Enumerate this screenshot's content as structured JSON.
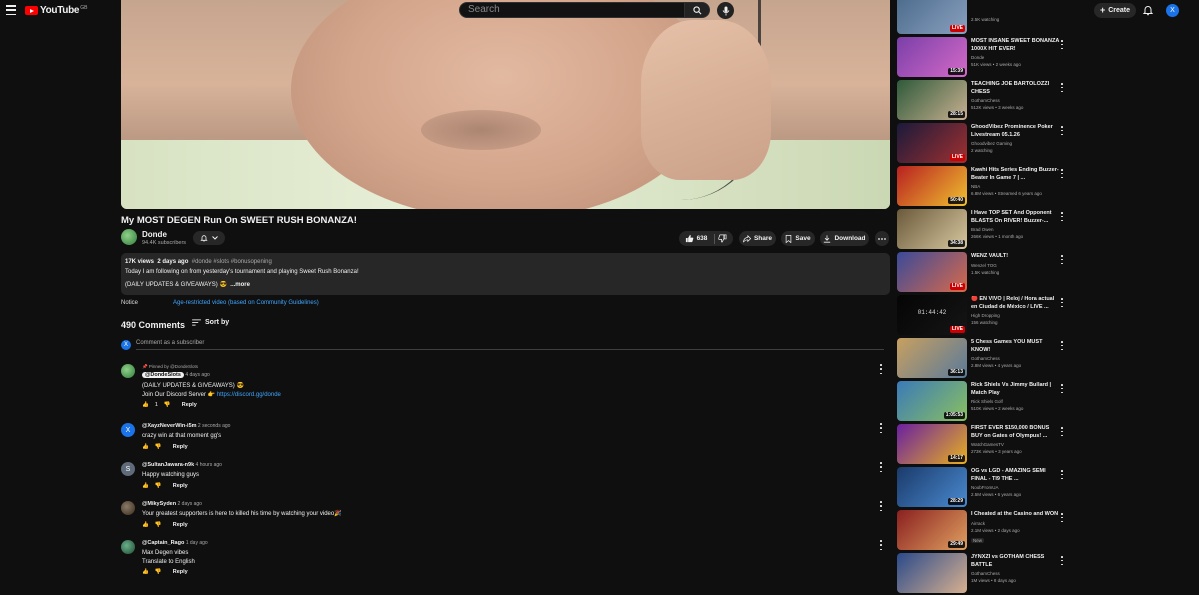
{
  "header": {
    "logo_text": "YouTube",
    "logo_country": "GB",
    "search_placeholder": "Search",
    "create_label": "Create",
    "user_initial": "X"
  },
  "video": {
    "title": "My MOST DEGEN Run On SWEET RUSH BONANZA!",
    "channel_name": "Donde",
    "subscribers": "94.4K subscribers",
    "likes": "638",
    "share_label": "Share",
    "save_label": "Save",
    "download_label": "Download"
  },
  "description": {
    "views": "17K views",
    "age": "2 days ago",
    "hashtags": "#donde #slots #bonusopening",
    "line1": "Today I am following on from yesterday's tournament and playing Sweet Rush Bonanza!",
    "line2": "(DAILY UPDATES & GIVEAWAYS) 😎",
    "more": "...more"
  },
  "notice": {
    "label": "Notice",
    "text": "Age-restricted video (based on Community Guidelines)"
  },
  "comments": {
    "count": "490 Comments",
    "sort_label": "Sort by",
    "add_placeholder": "Comment as a subscriber",
    "add_avatar_initial": "X",
    "reply_label": "Reply",
    "items": [
      {
        "pinned_text": "Pinned by @DondeSlots",
        "author": "@DondeSlots",
        "age": "4 days ago",
        "line1": "(DAILY UPDATES & GIVEAWAYS) 😎",
        "line2_prefix": "Join Our Discord Server 👉",
        "link": "https://discord.gg/donde",
        "likes": "1",
        "avatar_color": "#3b8a3e",
        "avatar_initial": ""
      },
      {
        "author": "@XayzNeverWin-i5m",
        "age": "2 seconds ago",
        "line1": "crazy win at that moment gg's",
        "avatar_color": "#1a73e8",
        "avatar_initial": "X"
      },
      {
        "author": "@SultanJawara-n9k",
        "age": "4 hours ago",
        "line1": "Happy watching guys",
        "avatar_color": "#5f6b7a",
        "avatar_initial": "S"
      },
      {
        "author": "@MikySyden",
        "age": "2 days ago",
        "line1": "Your greatest supporters is here to killed his time by watching your video🎉",
        "avatar_color": "#5a4a3a",
        "avatar_initial": ""
      },
      {
        "author": "@Captain_Rago",
        "age": "1 day ago",
        "line1": "Max Degen vibes",
        "line2": "Translate to English",
        "avatar_color": "#2e6b4a",
        "avatar_initial": ""
      }
    ]
  },
  "related": [
    {
      "title": "",
      "channel": "",
      "meta": "2.5K watching",
      "tag": "LIVE",
      "live": true,
      "colors": [
        "#4a6a8a",
        "#8aa0c0"
      ]
    },
    {
      "title": "MOST INSANE SWEET BONANZA 1000X HIT EVER!",
      "channel": "Donde",
      "meta": "51K views • 2 weeks ago",
      "tag": "15:39",
      "live": false,
      "colors": [
        "#7a3fa8",
        "#d46ac8"
      ]
    },
    {
      "title": "TEACHING JOE BARTOLOZZI CHESS",
      "channel": "GothamChess",
      "meta": "512K views • 3 weeks ago",
      "tag": "28:15",
      "live": false,
      "colors": [
        "#2f5a3a",
        "#c8b090"
      ]
    },
    {
      "title": "GhoodVibez Prominence Poker Livestream 05.1.26",
      "channel": "Ghoodvibez Gaming",
      "meta": "2 watching",
      "tag": "LIVE",
      "live": true,
      "colors": [
        "#1a1a3a",
        "#a03030"
      ]
    },
    {
      "title": "Kawhi Hits Series Ending Buzzer-Beater In Game 7 | ...",
      "channel": "NBA",
      "meta": "6.8M views • Streamed 6 years ago",
      "tag": "50:40",
      "live": false,
      "colors": [
        "#b82020",
        "#f0c030"
      ]
    },
    {
      "title": "I Have TOP SET And Opponent BLASTS On RIVER! Buzzer-...",
      "channel": "Brad Owen",
      "meta": "266K views • 1 month ago",
      "tag": "34:38",
      "live": false,
      "colors": [
        "#6a5a3a",
        "#d8c8a0"
      ]
    },
    {
      "title": "WENZ VAULT!",
      "channel": "Wenzel TOG",
      "meta": "1.5K watching",
      "tag": "LIVE",
      "live": true,
      "colors": [
        "#3a4a9a",
        "#d86a4a"
      ]
    },
    {
      "title": "🔴 EN VIVO | Reloj / Hora actual en Ciudad de México / LIVE ...",
      "channel": "High Dropping",
      "meta": "156 watching",
      "tag": "LIVE",
      "live": true,
      "clock": "01:44:42",
      "colors": [
        "#050505",
        "#151515"
      ]
    },
    {
      "title": "5 Chess Games YOU MUST KNOW!",
      "channel": "GothamChess",
      "meta": "2.8M views • 4 years ago",
      "tag": "36:13",
      "live": false,
      "colors": [
        "#c8a060",
        "#5a7a9a"
      ]
    },
    {
      "title": "Rick Shiels Vs Jimmy Bullard | Match Play",
      "channel": "Rick Shiels Golf",
      "meta": "510K views • 2 weeks ago",
      "tag": "1:05:53",
      "live": false,
      "colors": [
        "#3a7ab8",
        "#8ac060"
      ]
    },
    {
      "title": "FIRST EVER $150,000 BONUS BUY on Gates of Olympus! ...",
      "channel": "WatchGamesTV",
      "meta": "273K views • 3 years ago",
      "tag": "14:17",
      "live": false,
      "colors": [
        "#6a20a0",
        "#e8b020"
      ]
    },
    {
      "title": "OG vs LGD - AMAZING SEMI FINAL - TI9 THE ...",
      "channel": "NoobFromUA",
      "meta": "2.5M views • 6 years ago",
      "tag": "28:29",
      "live": false,
      "colors": [
        "#1a3a6a",
        "#4a8ad0"
      ]
    },
    {
      "title": "I Cheated at the Casino and WON",
      "channel": "Airrack",
      "meta": "2.1M views • 2 days ago",
      "tag": "29:49",
      "live": false,
      "new_label": "New",
      "colors": [
        "#8a2020",
        "#e0a060"
      ]
    },
    {
      "title": "JYNXZI vs GOTHAM CHESS BATTLE",
      "channel": "GothamChess",
      "meta": "1M views • 8 days ago",
      "tag": "",
      "live": false,
      "colors": [
        "#2a4a8a",
        "#d8b090"
      ]
    }
  ]
}
